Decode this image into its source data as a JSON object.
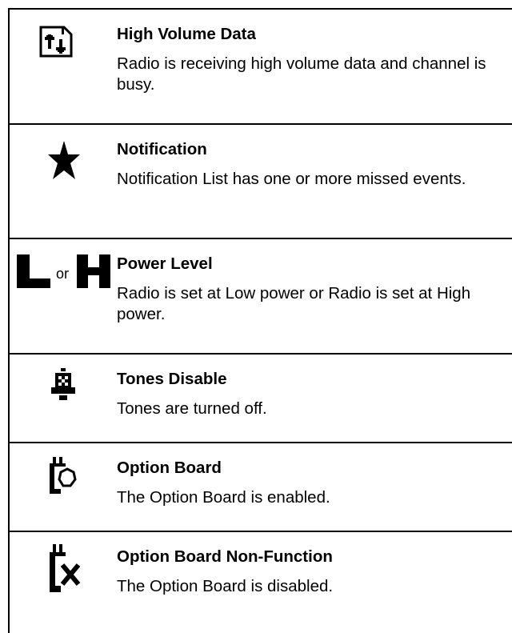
{
  "rows": [
    {
      "icon": "high-volume-data-icon",
      "title": "High Volume Data",
      "description": "Radio is receiving high volume data and channel is busy."
    },
    {
      "icon": "notification-star-icon",
      "title": "Notification",
      "description": "Notification List has one or more missed events."
    },
    {
      "icon": "power-level-icon",
      "or_text": "or",
      "title": "Power Level",
      "description": "Radio is set at Low power or Radio is set at High power."
    },
    {
      "icon": "tones-disable-bell-icon",
      "title": "Tones Disable",
      "description": "Tones are turned off."
    },
    {
      "icon": "option-board-icon",
      "title": "Option Board",
      "description": "The Option Board is enabled."
    },
    {
      "icon": "option-board-non-function-icon",
      "title": "Option Board Non-Function",
      "description": "The Option Board is disabled."
    }
  ]
}
